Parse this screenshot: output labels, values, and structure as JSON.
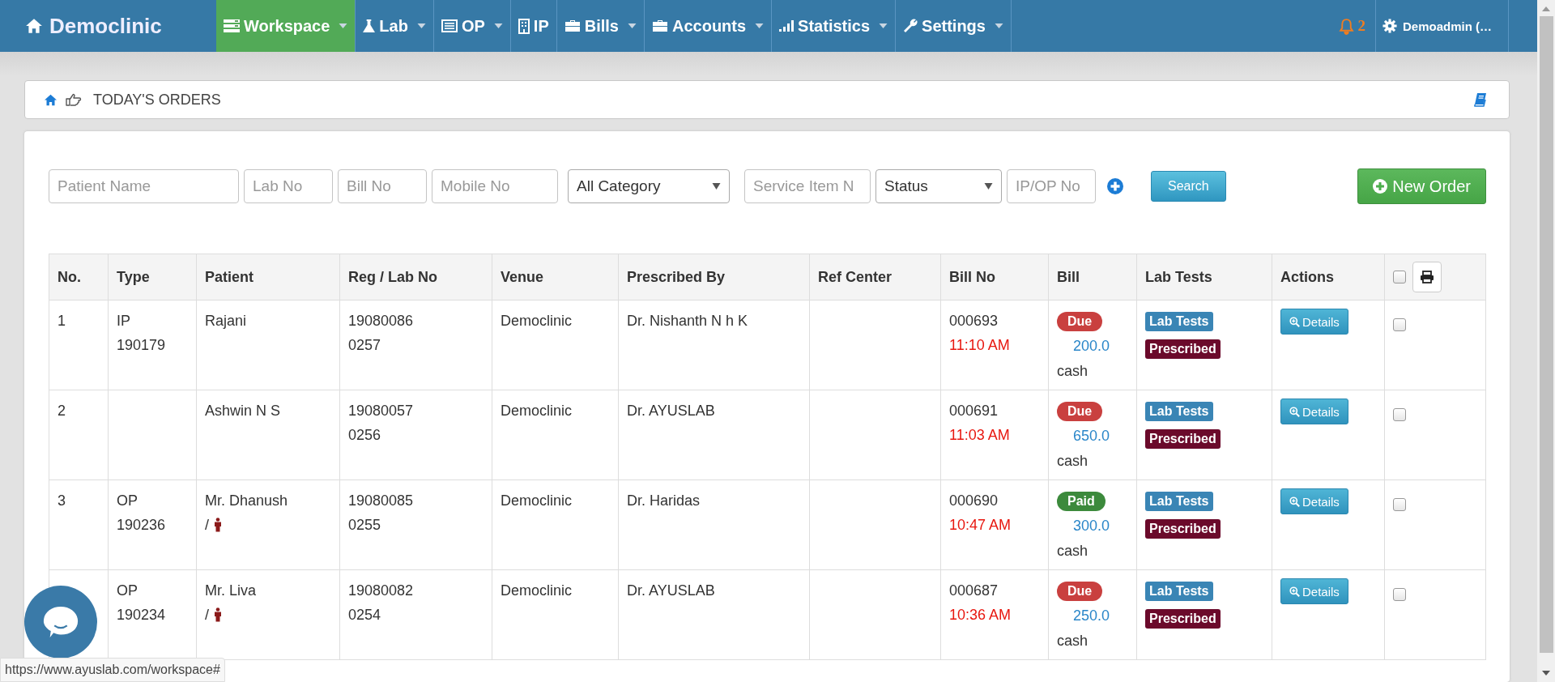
{
  "navbar": {
    "brand": "Democlinic",
    "menus": [
      {
        "label": "Workspace",
        "selected": true,
        "dropdown": true
      },
      {
        "label": "Lab",
        "selected": false,
        "dropdown": true
      },
      {
        "label": "OP",
        "selected": false,
        "dropdown": true
      },
      {
        "label": "IP",
        "selected": false,
        "dropdown": false
      },
      {
        "label": "Bills",
        "selected": false,
        "dropdown": true
      },
      {
        "label": "Accounts",
        "selected": false,
        "dropdown": true
      },
      {
        "label": "Statistics",
        "selected": false,
        "dropdown": true
      },
      {
        "label": "Settings",
        "selected": false,
        "dropdown": true
      }
    ],
    "notifications": "2",
    "user": "Demoadmin (…"
  },
  "breadcrumb": {
    "title": "TODAY'S ORDERS"
  },
  "filters": [
    {
      "kind": "input",
      "placeholder": "Patient Name"
    },
    {
      "kind": "input",
      "placeholder": "Lab No"
    },
    {
      "kind": "input",
      "placeholder": "Bill No"
    },
    {
      "kind": "input",
      "placeholder": "Mobile No"
    },
    {
      "kind": "select",
      "value": "All Category"
    },
    {
      "kind": "input",
      "placeholder": "Service Item N"
    },
    {
      "kind": "select",
      "value": "Status"
    },
    {
      "kind": "input",
      "placeholder": "IP/OP No"
    }
  ],
  "search_button": "Search",
  "new_order_button": "New Order",
  "table": {
    "columns": [
      "No.",
      "Type",
      "Patient",
      "Reg / Lab No",
      "Venue",
      "Prescribed By",
      "Ref Center",
      "Bill No",
      "Bill",
      "Lab Tests",
      "Actions"
    ],
    "select_all_checked": false,
    "rows": [
      {
        "no": "1",
        "type": "IP",
        "type_no": "190179",
        "patient": "Rajani",
        "reg_no": "19080086",
        "lab_no": "0257",
        "venue": "Democlinic",
        "prescribed_by": "Dr. Nishanth N h K",
        "bill_no": "000693",
        "time": "11:10 AM",
        "bill_status": "Due",
        "paid": false,
        "amount": "200.0",
        "payment_mode": "cash",
        "lab_tests": "Lab Tests",
        "lab_status": "Prescribed",
        "action": "Details",
        "checked": false
      },
      {
        "no": "2",
        "patient": "Ashwin N S",
        "reg_no": "19080057",
        "lab_no": "0256",
        "venue": "Democlinic",
        "prescribed_by": "Dr. AYUSLAB",
        "bill_no": "000691",
        "time": "11:03 AM",
        "bill_status": "Due",
        "paid": false,
        "amount": "650.0",
        "payment_mode": "cash",
        "lab_tests": "Lab Tests",
        "lab_status": "Prescribed",
        "action": "Details",
        "checked": false
      },
      {
        "no": "3",
        "type": "OP",
        "type_no": "190236",
        "patient": "Mr. Dhanush",
        "patient_suffix": "/",
        "reg_no": "19080085",
        "lab_no": "0255",
        "venue": "Democlinic",
        "prescribed_by": "Dr. Haridas",
        "bill_no": "000690",
        "time": "10:47 AM",
        "bill_status": "Paid",
        "paid": true,
        "amount": "300.0",
        "payment_mode": "cash",
        "lab_tests": "Lab Tests",
        "lab_status": "Prescribed",
        "action": "Details",
        "checked": false
      },
      {
        "type": "OP",
        "type_no": "190234",
        "patient": "Mr. Liva",
        "patient_suffix": "/",
        "reg_no": "19080082",
        "lab_no": "0254",
        "venue": "Democlinic",
        "prescribed_by": "Dr. AYUSLAB",
        "bill_no": "000687",
        "time": "10:36 AM",
        "bill_status": "Due",
        "paid": false,
        "amount": "250.0",
        "payment_mode": "cash",
        "lab_tests": "Lab Tests",
        "lab_status": "Prescribed",
        "action": "Details",
        "checked": false
      }
    ]
  },
  "status_url": "https://www.ayuslab.com/workspace#"
}
